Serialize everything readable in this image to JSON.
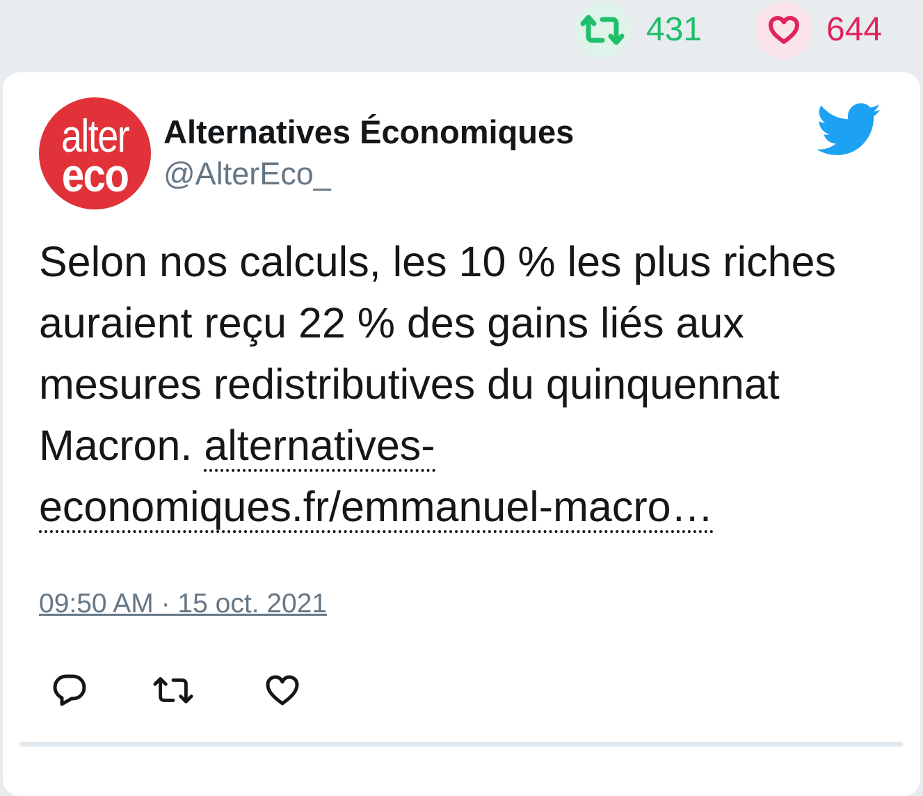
{
  "stats": {
    "retweet_count": "431",
    "like_count": "644",
    "retweet_icon": "retweet-icon",
    "like_icon": "heart-icon"
  },
  "tweet": {
    "avatar": {
      "line1": "alter",
      "line2": "eco",
      "color": "#e03238"
    },
    "author_name": "Alternatives Économiques",
    "author_handle": "@AlterEco_",
    "text_before_link": "Selon nos calculs, les 10 % les plus riches auraient reçu 22 % des gains liés aux mesures redistributives du quinquennat Macron. ",
    "link_text": "alternatives-economiques.fr/emmanuel-macro…",
    "timestamp": "09:50 AM · 15 oct. 2021"
  },
  "colors": {
    "retweet_green": "#1fbf6b",
    "like_pink": "#e0245e",
    "twitter_blue": "#1da1f2",
    "muted_gray": "#657786"
  },
  "actions": {
    "reply_icon": "reply-icon",
    "retweet_icon": "retweet-icon",
    "like_icon": "heart-icon"
  }
}
